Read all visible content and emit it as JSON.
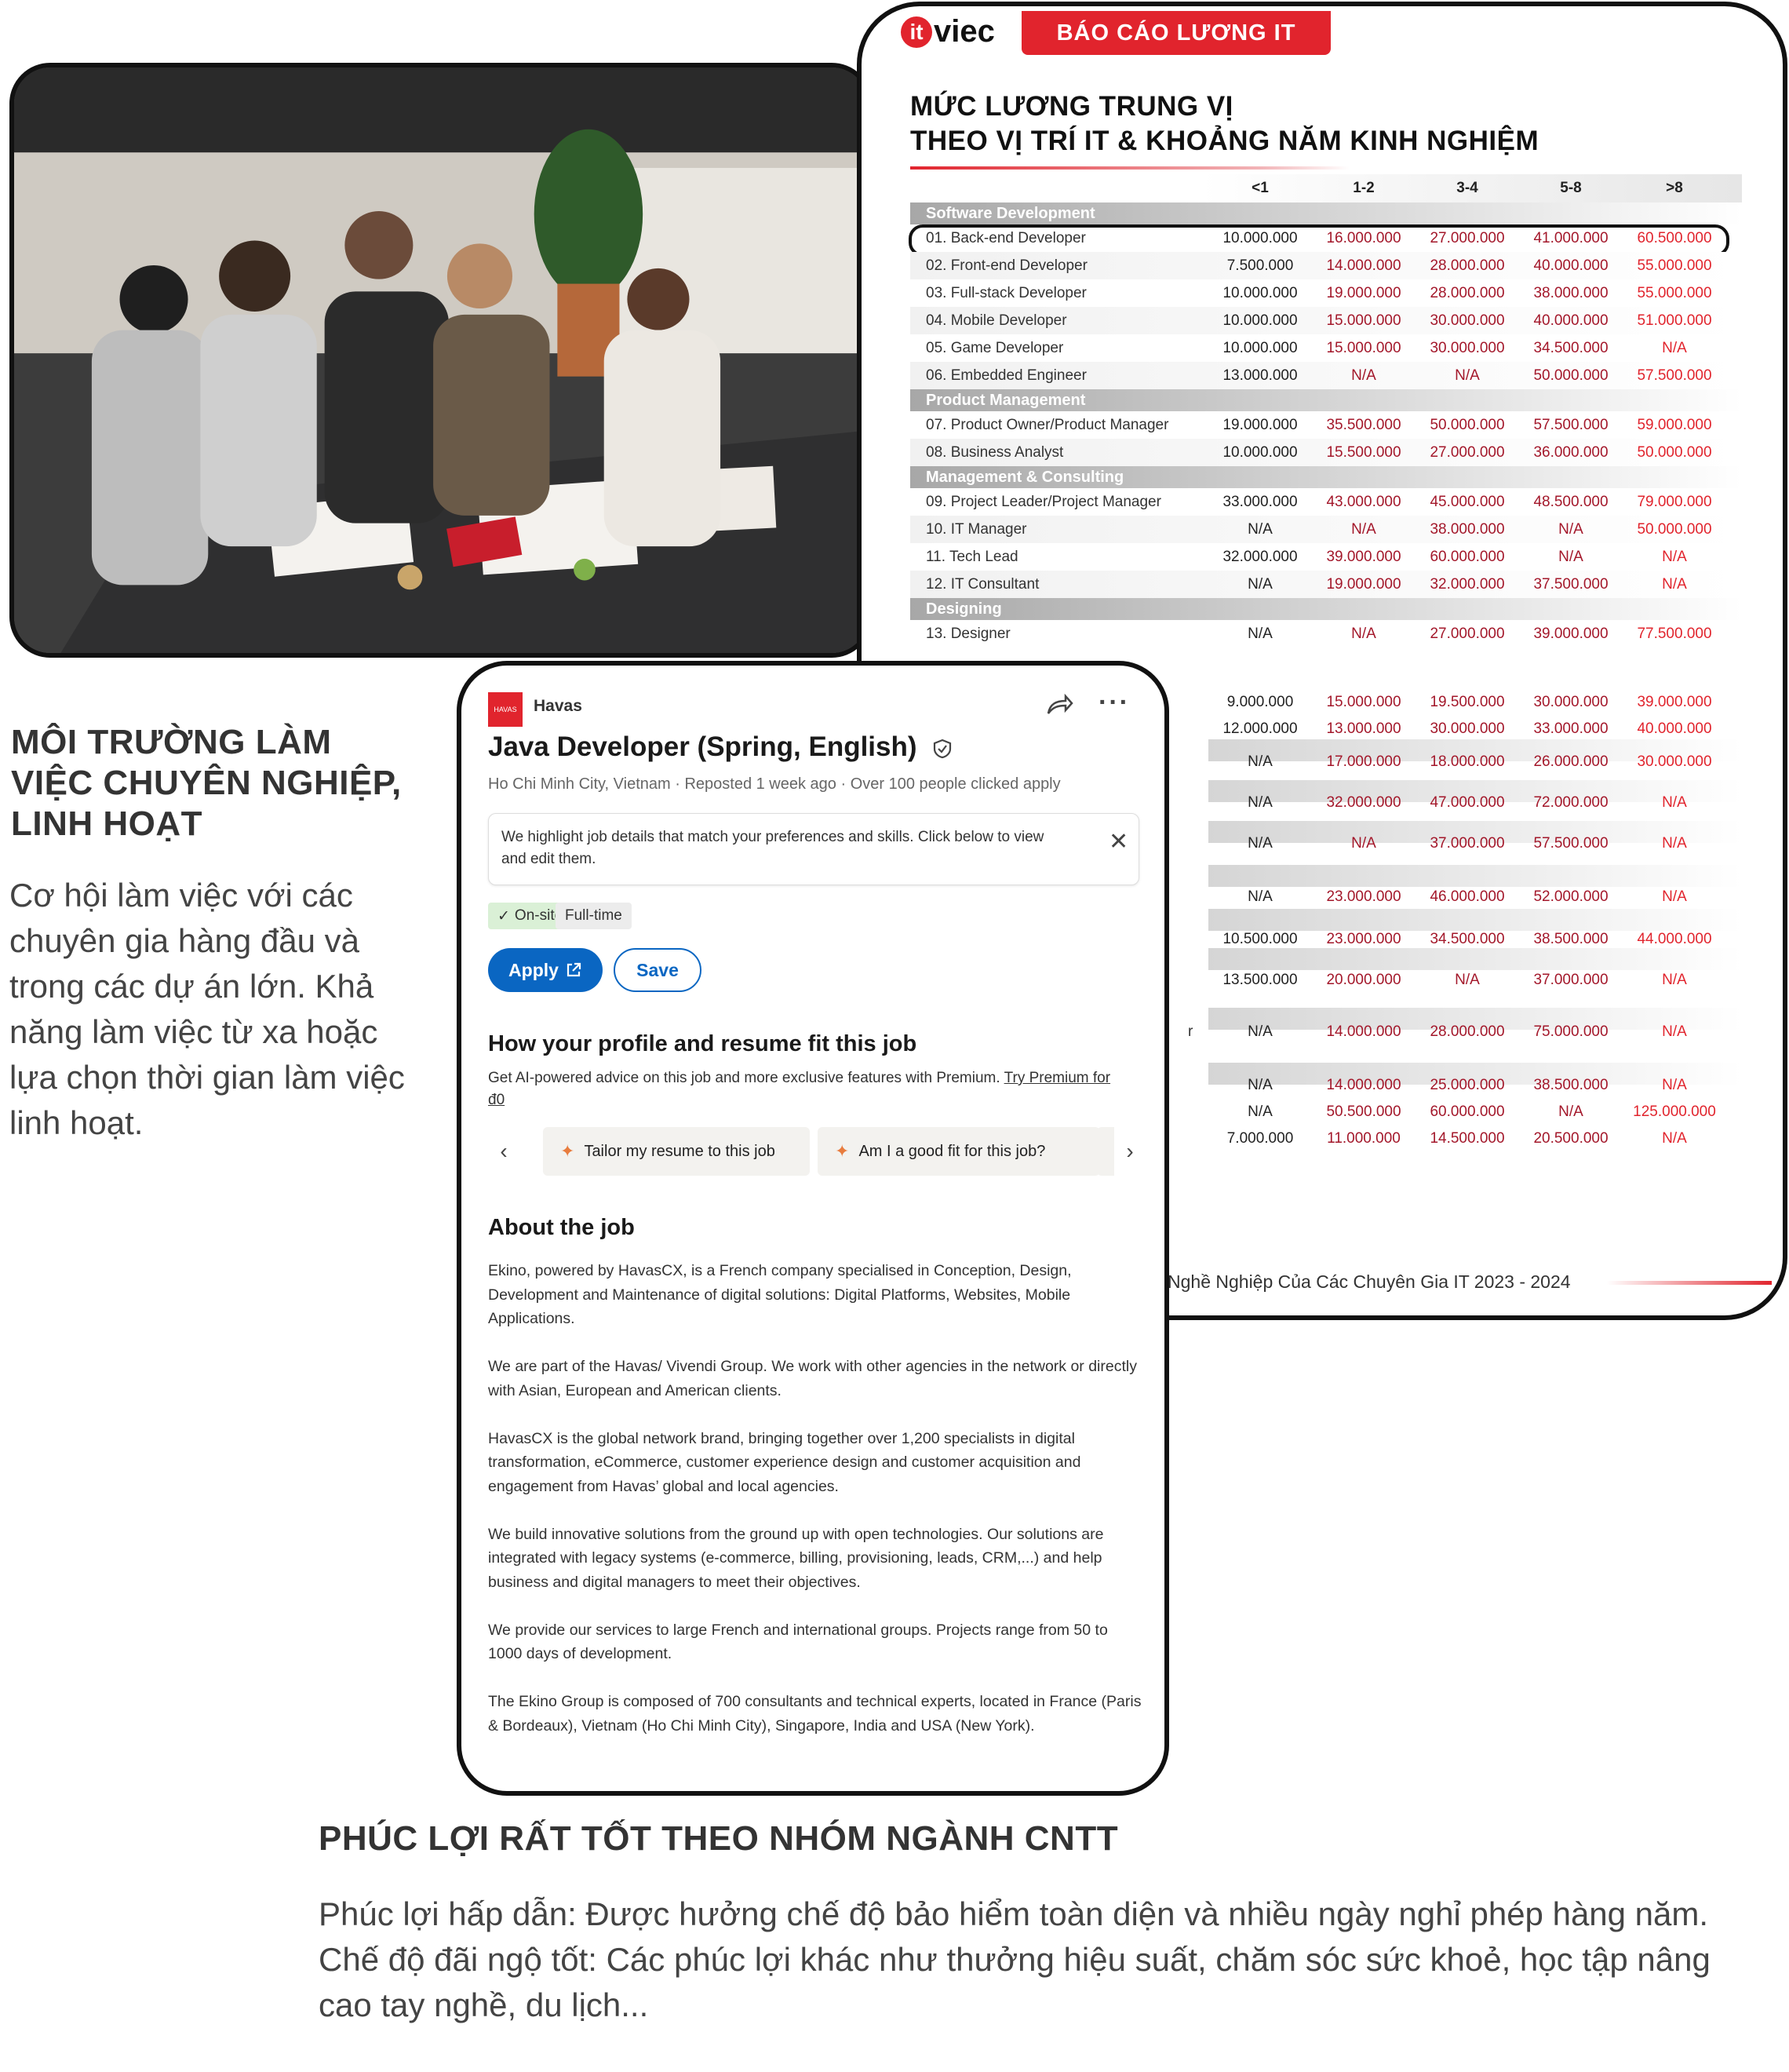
{
  "report": {
    "logo_mark": "it",
    "logo_text": "viec",
    "banner": "BÁO CÁO LƯƠNG IT",
    "title_line1": "MỨC LƯƠNG TRUNG VỊ",
    "title_line2": "THEO VỊ TRÍ IT & KHOẢNG NĂM KINH NGHIỆM",
    "columns": [
      "<1",
      "1-2",
      "3-4",
      "5-8",
      ">8"
    ],
    "sections": [
      {
        "name": "Software Development",
        "rows": [
          {
            "role": "01. Back-end Developer",
            "values": [
              "10.000.000",
              "16.000.000",
              "27.000.000",
              "41.000.000",
              "60.500.000"
            ],
            "highlight": true
          },
          {
            "role": "02. Front-end Developer",
            "values": [
              "7.500.000",
              "14.000.000",
              "28.000.000",
              "40.000.000",
              "55.000.000"
            ]
          },
          {
            "role": "03. Full-stack Developer",
            "values": [
              "10.000.000",
              "19.000.000",
              "28.000.000",
              "38.000.000",
              "55.000.000"
            ]
          },
          {
            "role": "04. Mobile Developer",
            "values": [
              "10.000.000",
              "15.000.000",
              "30.000.000",
              "40.000.000",
              "51.000.000"
            ]
          },
          {
            "role": "05. Game Developer",
            "values": [
              "10.000.000",
              "15.000.000",
              "30.000.000",
              "34.500.000",
              "N/A"
            ]
          },
          {
            "role": "06. Embedded Engineer",
            "values": [
              "13.000.000",
              "N/A",
              "N/A",
              "50.000.000",
              "57.500.000"
            ]
          }
        ]
      },
      {
        "name": "Product Management",
        "rows": [
          {
            "role": "07. Product Owner/Product Manager",
            "values": [
              "19.000.000",
              "35.500.000",
              "50.000.000",
              "57.500.000",
              "59.000.000"
            ]
          },
          {
            "role": "08. Business Analyst",
            "values": [
              "10.000.000",
              "15.500.000",
              "27.000.000",
              "36.000.000",
              "50.000.000"
            ]
          }
        ]
      },
      {
        "name": "Management & Consulting",
        "rows": [
          {
            "role": "09. Project Leader/Project Manager",
            "values": [
              "33.000.000",
              "43.000.000",
              "45.000.000",
              "48.500.000",
              "79.000.000"
            ]
          },
          {
            "role": "10. IT Manager",
            "values": [
              "N/A",
              "N/A",
              "38.000.000",
              "N/A",
              "50.000.000"
            ]
          },
          {
            "role": "11. Tech Lead",
            "values": [
              "32.000.000",
              "39.000.000",
              "60.000.000",
              "N/A",
              "N/A"
            ]
          },
          {
            "role": "12. IT Consultant",
            "values": [
              "N/A",
              "19.000.000",
              "32.000.000",
              "37.500.000",
              "N/A"
            ]
          }
        ]
      },
      {
        "name": "Designing",
        "rows": [
          {
            "role": "13. Designer",
            "values": [
              "N/A",
              "N/A",
              "27.000.000",
              "39.000.000",
              "77.500.000"
            ]
          }
        ]
      }
    ],
    "partial_rows": [
      [
        "9.000.000",
        "15.000.000",
        "19.500.000",
        "30.000.000",
        "39.000.000"
      ],
      [
        "12.000.000",
        "13.000.000",
        "30.000.000",
        "33.000.000",
        "40.000.000"
      ],
      [
        "N/A",
        "17.000.000",
        "18.000.000",
        "26.000.000",
        "30.000.000"
      ],
      [
        "N/A",
        "32.000.000",
        "47.000.000",
        "72.000.000",
        "N/A"
      ],
      [
        "N/A",
        "N/A",
        "37.000.000",
        "57.500.000",
        "N/A"
      ],
      [
        "N/A",
        "23.000.000",
        "46.000.000",
        "52.000.000",
        "N/A"
      ],
      [
        "10.500.000",
        "23.000.000",
        "34.500.000",
        "38.500.000",
        "44.000.000"
      ],
      [
        "13.500.000",
        "20.000.000",
        "N/A",
        "37.000.000",
        "N/A"
      ],
      [
        "N/A",
        "14.000.000",
        "28.000.000",
        "75.000.000",
        "N/A"
      ],
      [
        "N/A",
        "14.000.000",
        "25.000.000",
        "38.500.000",
        "N/A"
      ],
      [
        "N/A",
        "50.500.000",
        "60.000.000",
        "N/A",
        "125.000.000"
      ],
      [
        "7.000.000",
        "11.000.000",
        "14.500.000",
        "20.500.000",
        "N/A"
      ]
    ],
    "partial_label_fragment": "r",
    "footer": "Nghề Nghiệp Của Các Chuyên Gia IT 2023 - 2024"
  },
  "left_section": {
    "heading": "MÔI TRƯỜNG LÀM VIỆC CHUYÊN NGHIỆP, LINH HOẠT",
    "body": "Cơ hội làm việc với các chuyên gia hàng đầu và trong các dự án lớn. Khả năng làm việc từ xa hoặc lựa chọn thời gian làm việc linh hoạt."
  },
  "job": {
    "company_logo_text": "HAVAS",
    "company": "Havas",
    "title": "Java Developer (Spring, English)",
    "meta": "Ho Chi Minh City, Vietnam · Reposted 1 week ago · Over 100 people clicked apply",
    "hint": "We highlight job details that match your preferences and skills. Click below to view and edit them.",
    "tag_onsite": "On-site",
    "tag_fulltime": "Full-time",
    "apply_label": "Apply",
    "save_label": "Save",
    "fit_heading": "How your profile and resume fit this job",
    "fit_sub": "Get AI-powered advice on this job and more exclusive features with Premium.",
    "fit_link": "Try Premium for đ0",
    "chip_tailor": "Tailor my resume to this job",
    "chip_fit": "Am I a good fit for this job?",
    "about_heading": "About the job",
    "about_paragraphs": [
      "Ekino, powered by HavasCX, is a French company specialised in Conception, Design, Development and Maintenance of digital solutions: Digital Platforms, Websites, Mobile Applications.",
      "We are part of the Havas/ Vivendi Group. We work with other agencies in the network or directly with Asian, European and American clients.",
      "HavasCX is the global network brand, bringing together over 1,200 specialists in digital transformation, eCommerce, customer experience design and customer acquisition and engagement from Havas’ global and local agencies.",
      "We build innovative solutions from the ground up with open technologies. Our solutions are integrated with legacy systems (e-commerce, billing, provisioning, leads, CRM,...) and help business and digital managers to meet their objectives.",
      "We provide our services to large French and international groups. Projects range from 50 to 1000 days of development.",
      "The Ekino Group is composed of 700 consultants and technical experts, located in France (Paris & Bordeaux), Vietnam (Ho Chi Minh City), Singapore, India and USA (New York)."
    ]
  },
  "bottom_section": {
    "heading": "PHÚC LỢI RẤT TỐT THEO NHÓM NGÀNH CNTT",
    "line1": "Phúc lợi hấp dẫn: Được hưởng chế độ bảo hiểm toàn diện và nhiều ngày nghỉ phép hàng năm.",
    "line2": "Chế độ đãi ngộ tốt: Các phúc lợi khác như thưởng hiệu suất, chăm sóc sức khoẻ, học tập nâng cao tay nghề, du lịch..."
  },
  "colors": {
    "brand_red": "#e1242d",
    "linkedin_blue": "#0a66c2",
    "salary_dark_red": "#a3172a",
    "text_gray": "#444444"
  }
}
